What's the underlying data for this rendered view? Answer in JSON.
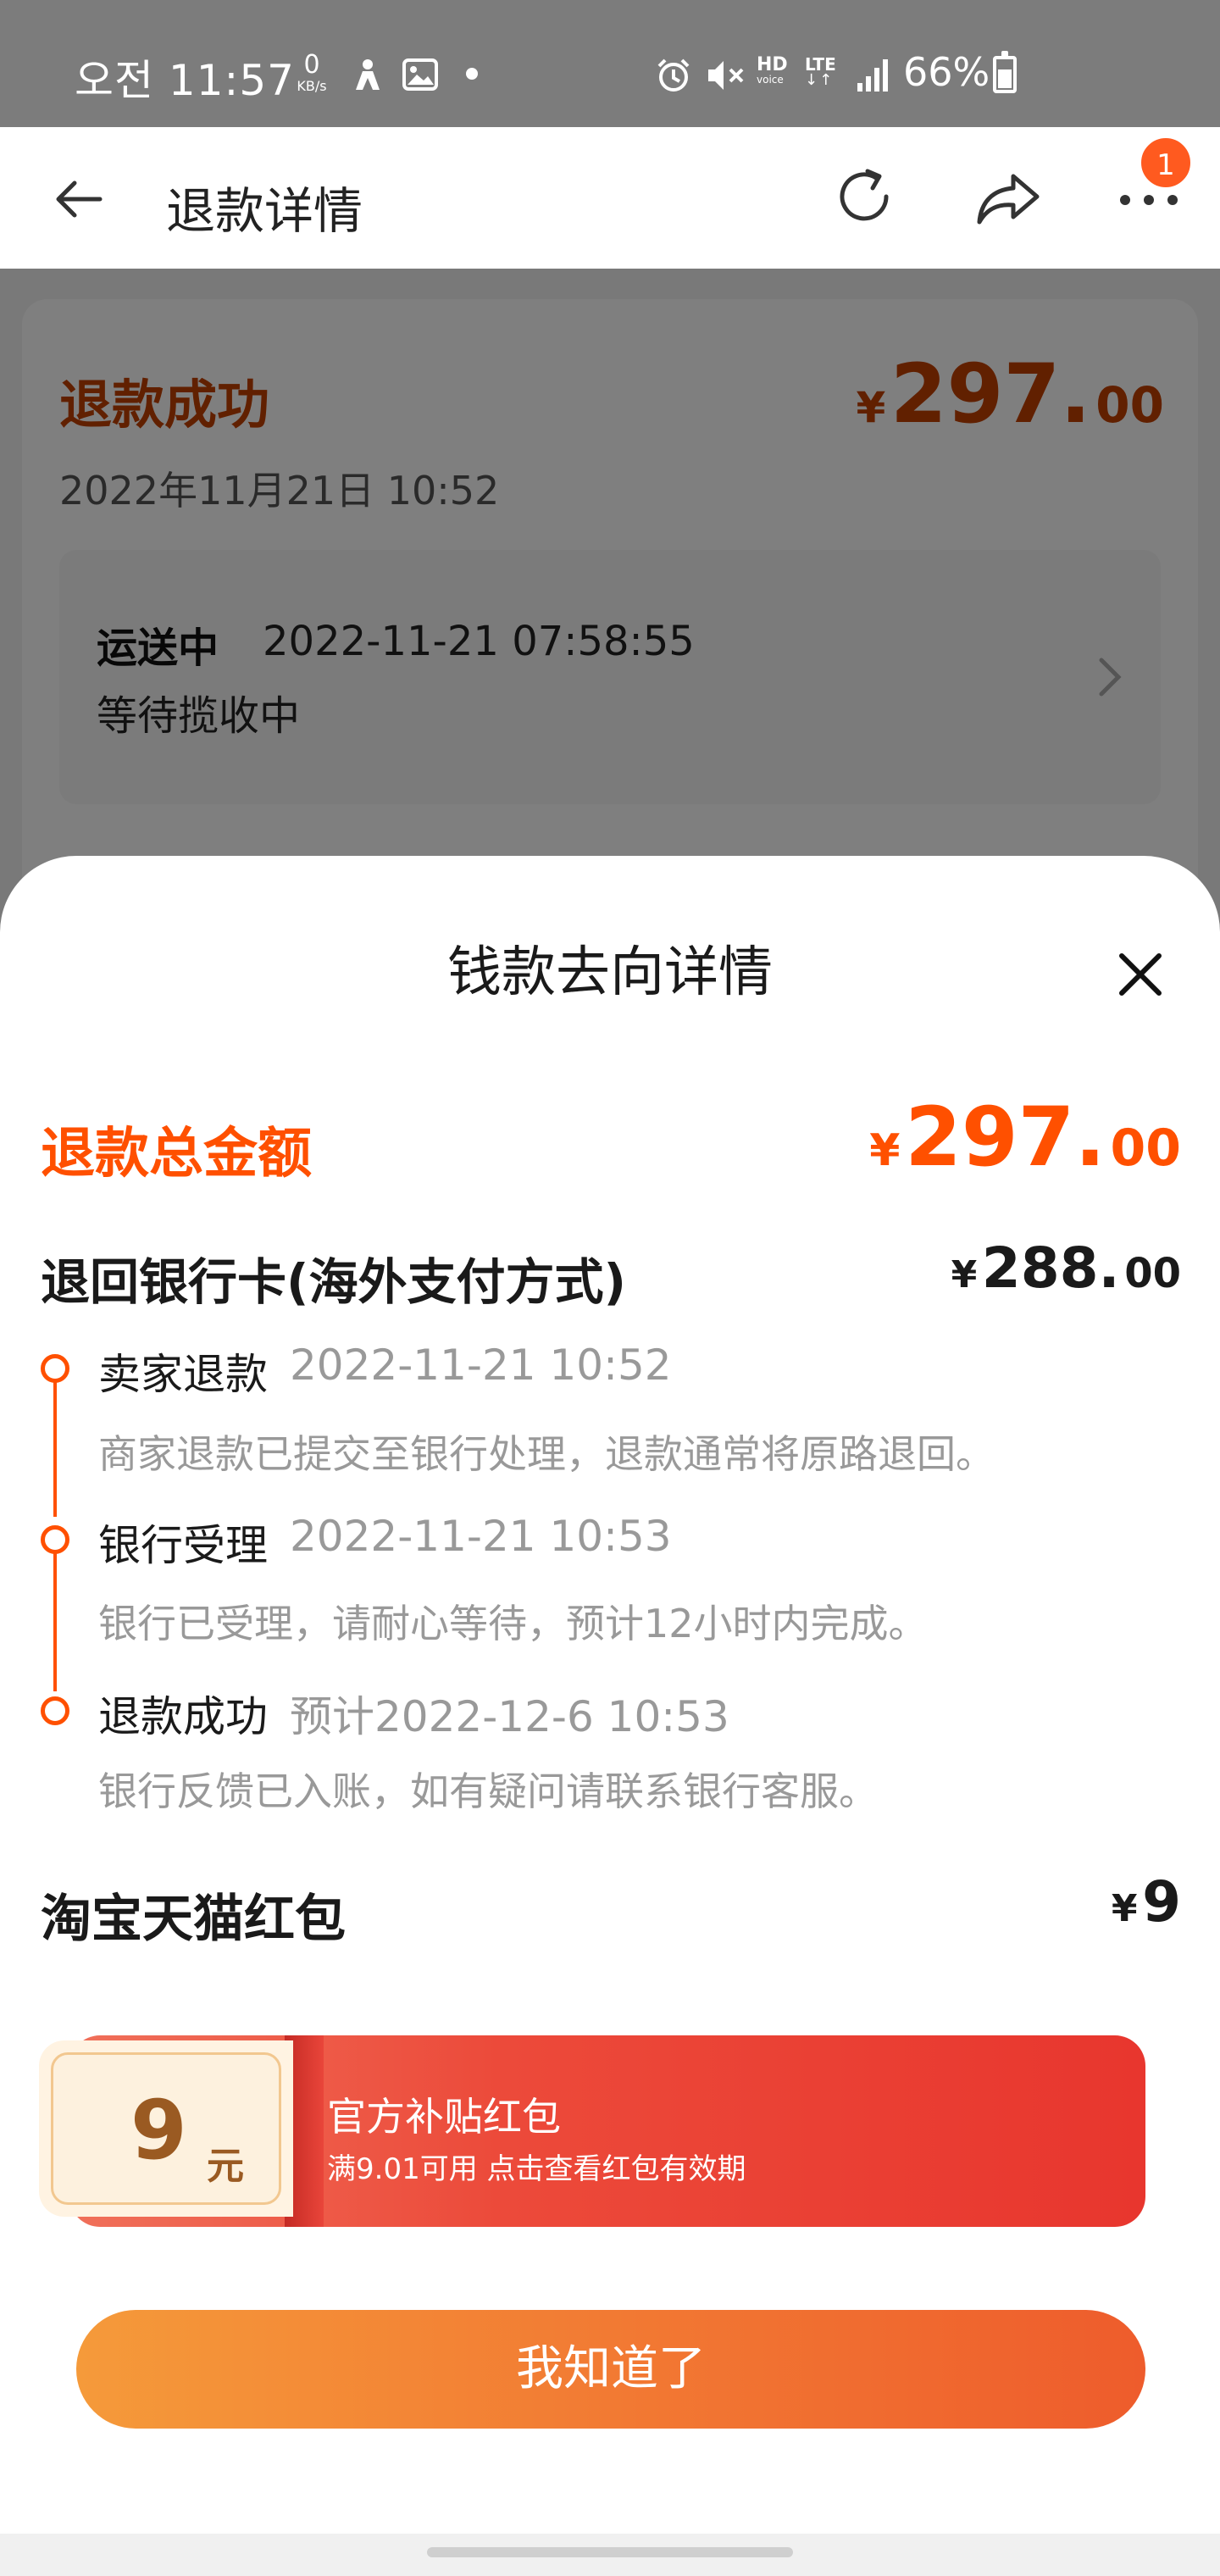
{
  "status_bar": {
    "time": "오전 11:57",
    "net_speed": "0",
    "net_unit": "KB/s",
    "hd_label": "HD",
    "hd_sub": "voice",
    "lte_label": "LTE",
    "lte_sub": "↓↑",
    "battery": "66%",
    "icons": [
      "wifi-calling-icon",
      "image-icon",
      "dot-icon",
      "alarm-icon",
      "mute-icon",
      "signal-icon",
      "battery-icon"
    ]
  },
  "nav": {
    "title": "退款详情",
    "badge": "1",
    "icons": [
      "back-arrow-icon",
      "refresh-icon",
      "share-icon",
      "more-icon"
    ]
  },
  "background": {
    "status": "退款成功",
    "amount_currency": "¥",
    "amount_int": "297.",
    "amount_dec": "00",
    "date": "2022年11月21日 10:52",
    "shipping_status": "运送中",
    "shipping_time": "2022-11-21 07:58:55",
    "shipping_desc": "等待揽收中"
  },
  "sheet": {
    "title": "钱款去向详情",
    "total_label": "退款总金额",
    "total_currency": "¥",
    "total_int": "297.",
    "total_dec": "00",
    "bank_label": "退回银行卡(海外支付方式)",
    "bank_currency": "¥",
    "bank_int": "288.",
    "bank_dec": "00",
    "timeline": [
      {
        "name": "卖家退款",
        "time": "2022-11-21 10:52",
        "desc": "商家退款已提交至银行处理，退款通常将原路退回。"
      },
      {
        "name": "银行受理",
        "time": "2022-11-21 10:53",
        "desc": "银行已受理，请耐心等待，预计12小时内完成。"
      },
      {
        "name": "退款成功",
        "time": "预计2022-12-6 10:53",
        "desc": "银行反馈已入账，如有疑问请联系银行客服。"
      }
    ],
    "hongbao_label": "淘宝天猫红包",
    "hongbao_currency": "¥",
    "hongbao_amount": "9",
    "coupon": {
      "value": "9",
      "unit": "元",
      "title": "官方补贴红包",
      "subtitle": "满9.01可用 点击查看红包有效期"
    },
    "confirm_button": "我知道了"
  },
  "colors": {
    "accent": "#ff5000",
    "background_accent": "#c24000",
    "coupon_red": "#e8362e",
    "button_orange": "#f27a33"
  }
}
